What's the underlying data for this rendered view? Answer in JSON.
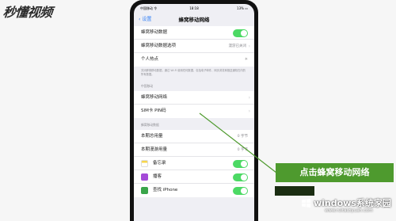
{
  "watermark": {
    "logo_text": "秒懂视频"
  },
  "status_bar": {
    "carrier": "中国移动 令",
    "time": "18:18",
    "battery": "13% ▭"
  },
  "nav": {
    "back_label": "设置",
    "title": "蜂窝移动网络"
  },
  "group1": {
    "cellular_data": "蜂窝移动数据",
    "cellular_options": "蜂窝移动数据选项",
    "cellular_options_value": "漫游已关闭",
    "hotspot": "个人热点"
  },
  "note": "关闭蜂窝移动数据，通过 Wi-Fi 使用任何数据，包括电子邮件、网页浏览和推送通知在内的所有数据。",
  "section_carrier": "中国移动",
  "group2": {
    "network": "蜂窝移动网络",
    "sim_pin": "SIM卡 PIN码"
  },
  "section_usage": "蜂窝移动数据",
  "group3": {
    "current_period": "本期总用量",
    "current_period_value": "0 字节",
    "roaming": "本期漫游用量",
    "roaming_value": "0 字节",
    "app_notes": "备忘录",
    "app_podcasts": "播客",
    "app_find": "查找 iPhone"
  },
  "callout": {
    "text": "点击蜂窝移动网络"
  },
  "windows_watermark": {
    "brand": "windows系统家园",
    "url": "www.ruitaiziyuan.com"
  }
}
